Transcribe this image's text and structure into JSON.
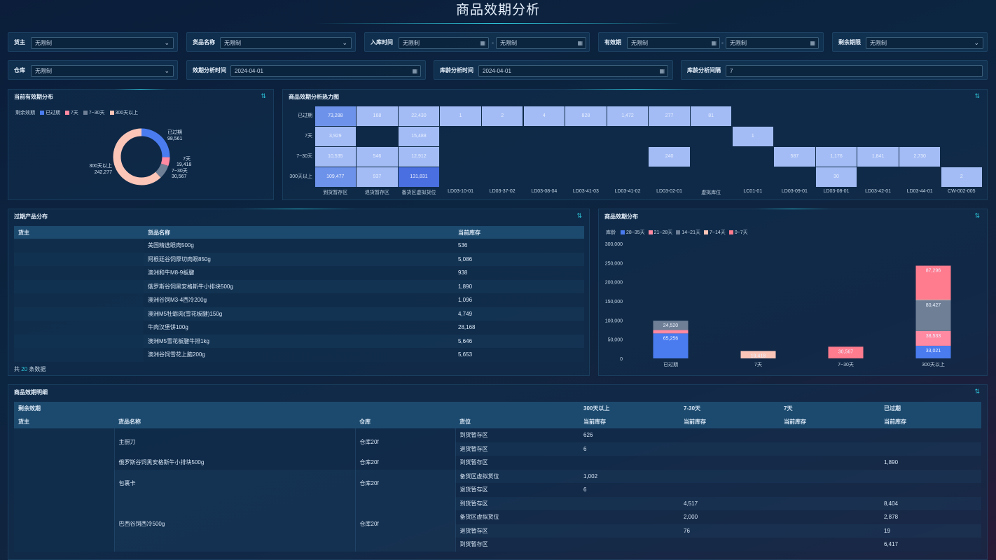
{
  "page_title": "商品效期分析",
  "filters": {
    "owner": {
      "label": "货主",
      "value": "无限制"
    },
    "product_name": {
      "label": "货品名称",
      "value": "无限制"
    },
    "inbound_time": {
      "label": "入库时间",
      "from": "无限制",
      "to": "无限制"
    },
    "expiry": {
      "label": "有效期",
      "from": "无限制",
      "to": "无限制"
    },
    "remaining": {
      "label": "剩余期限",
      "value": "无限制"
    },
    "warehouse": {
      "label": "仓库",
      "value": "无限制"
    },
    "expiry_analysis_time": {
      "label": "效期分析时间",
      "value": "2024-04-01"
    },
    "age_analysis_time": {
      "label": "库龄分析时间",
      "value": "2024-04-01"
    },
    "age_interval": {
      "label": "库龄分析间隔",
      "value": "7"
    }
  },
  "donut": {
    "title": "当前有效期分布",
    "legend_title": "剩余效期",
    "colors": [
      "#4a7cf0",
      "#ff8aa2",
      "#6e7f96",
      "#fbc5b8"
    ],
    "labels": [
      {
        "name": "已过期",
        "value": "98,561"
      },
      {
        "name": "7天",
        "value": "19,418"
      },
      {
        "name": "7~30天",
        "value": "30,567"
      },
      {
        "name": "300天以上",
        "value": "242,277"
      }
    ]
  },
  "heatmap": {
    "title": "商品效期分析热力图",
    "chart_data": {
      "type": "heatmap",
      "rows": [
        "已过期",
        "7天",
        "7~30天",
        "300天以上"
      ],
      "columns": [
        "到货暂存区",
        "退货暂存区",
        "备货区虚拟货位",
        "LD03-10-01",
        "LD03-37-02",
        "LD03-08-04",
        "LD03-41-03",
        "LD03-41-02",
        "LD03-02-01",
        "虚拟库位",
        "LC01-01",
        "LD03-09-01",
        "LD03-08-01",
        "LD03-42-01",
        "LD03-44-01",
        "CW-002-005"
      ],
      "cells": [
        {
          "row": 0,
          "col": 0,
          "value": "73,288",
          "level": 2
        },
        {
          "row": 0,
          "col": 1,
          "value": "168",
          "level": 1
        },
        {
          "row": 0,
          "col": 2,
          "value": "22,430",
          "level": 1
        },
        {
          "row": 0,
          "col": 3,
          "value": "1",
          "level": 1
        },
        {
          "row": 0,
          "col": 4,
          "value": "2",
          "level": 1
        },
        {
          "row": 0,
          "col": 5,
          "value": "4",
          "level": 1
        },
        {
          "row": 0,
          "col": 6,
          "value": "828",
          "level": 1
        },
        {
          "row": 0,
          "col": 7,
          "value": "1,472",
          "level": 1
        },
        {
          "row": 0,
          "col": 8,
          "value": "277",
          "level": 1
        },
        {
          "row": 0,
          "col": 9,
          "value": "81",
          "level": 1
        },
        {
          "row": 1,
          "col": 0,
          "value": "3,929",
          "level": 1
        },
        {
          "row": 1,
          "col": 2,
          "value": "15,488",
          "level": 1
        },
        {
          "row": 1,
          "col": 10,
          "value": "1",
          "level": 1
        },
        {
          "row": 2,
          "col": 0,
          "value": "10,535",
          "level": 1
        },
        {
          "row": 2,
          "col": 1,
          "value": "546",
          "level": 1
        },
        {
          "row": 2,
          "col": 2,
          "value": "12,912",
          "level": 1
        },
        {
          "row": 2,
          "col": 8,
          "value": "240",
          "level": 1
        },
        {
          "row": 2,
          "col": 11,
          "value": "587",
          "level": 1
        },
        {
          "row": 2,
          "col": 12,
          "value": "1,176",
          "level": 1
        },
        {
          "row": 2,
          "col": 13,
          "value": "1,841",
          "level": 1
        },
        {
          "row": 2,
          "col": 14,
          "value": "2,730",
          "level": 1
        },
        {
          "row": 3,
          "col": 0,
          "value": "109,477",
          "level": 2
        },
        {
          "row": 3,
          "col": 1,
          "value": "937",
          "level": 1
        },
        {
          "row": 3,
          "col": 2,
          "value": "131,831",
          "level": 3
        },
        {
          "row": 3,
          "col": 12,
          "value": "30",
          "level": 1
        },
        {
          "row": 3,
          "col": 15,
          "value": "2",
          "level": 1
        }
      ]
    }
  },
  "expired": {
    "title": "过期产品分布",
    "headers": [
      "货主",
      "货品名称",
      "当前库存"
    ],
    "rows": [
      [
        "",
        "美国精选眼肉500g",
        "536"
      ],
      [
        "",
        "阿根廷谷饲厚切肉眼850g",
        "5,086"
      ],
      [
        "",
        "澳洲和牛M8-9板腱",
        "938"
      ],
      [
        "",
        "俄罗斯谷饲黑安格斯牛小排块500g",
        "1,890"
      ],
      [
        "",
        "澳洲谷饲M3-4西冷200g",
        "1,096"
      ],
      [
        "",
        "澳洲M5牡蛎肉(雪花板腱)150g",
        "4,749"
      ],
      [
        "",
        "牛肉汉堡饼100g",
        "28,168"
      ],
      [
        "",
        "澳洲M5雪花板腱牛排1kg",
        "5,646"
      ],
      [
        "",
        "澳洲谷饲雪花上脑200g",
        "5,653"
      ]
    ],
    "footer_prefix": "共",
    "footer_count": "20",
    "footer_suffix": "条数据"
  },
  "stack": {
    "title": "商品效期分布",
    "legend_title": "库龄",
    "chart_data": {
      "type": "bar",
      "stacked": true,
      "categories": [
        "已过期",
        "7天",
        "7~30天",
        "300天以上"
      ],
      "ylim": [
        0,
        300000
      ],
      "yticks": [
        "0",
        "50,000",
        "100,000",
        "150,000",
        "200,000",
        "250,000",
        "300,000"
      ],
      "series": [
        {
          "name": "28~35天",
          "color": "#4a7cf0",
          "values": [
            65256,
            0,
            0,
            33021
          ],
          "labels": [
            "65,256",
            "",
            "",
            "33,021"
          ]
        },
        {
          "name": "21~28天",
          "color": "#ff8aa2",
          "values": [
            8780,
            0,
            0,
            38533
          ],
          "labels": [
            "",
            "",
            "",
            "38,533"
          ]
        },
        {
          "name": "14~21天",
          "color": "#6e7f96",
          "values": [
            24520,
            0,
            0,
            80427
          ],
          "labels": [
            "24,520",
            "",
            "",
            "80,427"
          ]
        },
        {
          "name": "7~14天",
          "color": "#fbc5b8",
          "values": [
            0,
            19418,
            0,
            2000
          ],
          "labels": [
            "",
            "19,418",
            "",
            ""
          ]
        },
        {
          "name": "0~7天",
          "color": "#ff7b8e",
          "values": [
            0,
            0,
            30567,
            88296
          ],
          "labels": [
            "",
            "",
            "30,567",
            "87,296"
          ]
        }
      ]
    }
  },
  "detail": {
    "title": "商品效期明细",
    "group_header_left": "剩余效期",
    "groups": [
      "300天以上",
      "7-30天",
      "7天",
      "已过期"
    ],
    "headers": [
      "货主",
      "货品名称",
      "仓库",
      "货位"
    ],
    "stock_label": "当前库存",
    "rows": [
      {
        "product": "主厨刀",
        "wh": "仓库20f",
        "loc": "到货暂存区",
        "v": [
          "626",
          "",
          "",
          ""
        ],
        "pspan": 2
      },
      {
        "product": "",
        "wh": "",
        "loc": "退货暂存区",
        "v": [
          "6",
          "",
          "",
          ""
        ],
        "cont": true
      },
      {
        "product": "俄罗斯谷饲黑安格斯牛小排块500g",
        "wh": "仓库20f",
        "loc": "到货暂存区",
        "v": [
          "",
          "",
          "",
          "1,890"
        ],
        "pspan": 1
      },
      {
        "product": "包裹卡",
        "wh": "仓库20f",
        "loc": "备货区虚拟货位",
        "v": [
          "1,002",
          "",
          "",
          ""
        ],
        "pspan": 2
      },
      {
        "product": "",
        "wh": "",
        "loc": "退货暂存区",
        "v": [
          "6",
          "",
          "",
          ""
        ],
        "cont": true
      },
      {
        "product": "巴西谷饲西冷500g",
        "wh": "仓库20f",
        "loc": "到货暂存区",
        "v": [
          "",
          "4,517",
          "",
          "8,404"
        ],
        "pspan": 4
      },
      {
        "product": "",
        "wh": "",
        "loc": "备货区虚拟货位",
        "v": [
          "",
          "2,000",
          "",
          "2,878"
        ],
        "cont": true
      },
      {
        "product": "",
        "wh": "",
        "loc": "退货暂存区",
        "v": [
          "",
          "76",
          "",
          "19"
        ],
        "cont": true
      },
      {
        "product": "",
        "wh": "",
        "loc": "到货暂存区",
        "v": [
          "",
          "",
          "",
          "6,417"
        ],
        "cont": true
      }
    ]
  }
}
